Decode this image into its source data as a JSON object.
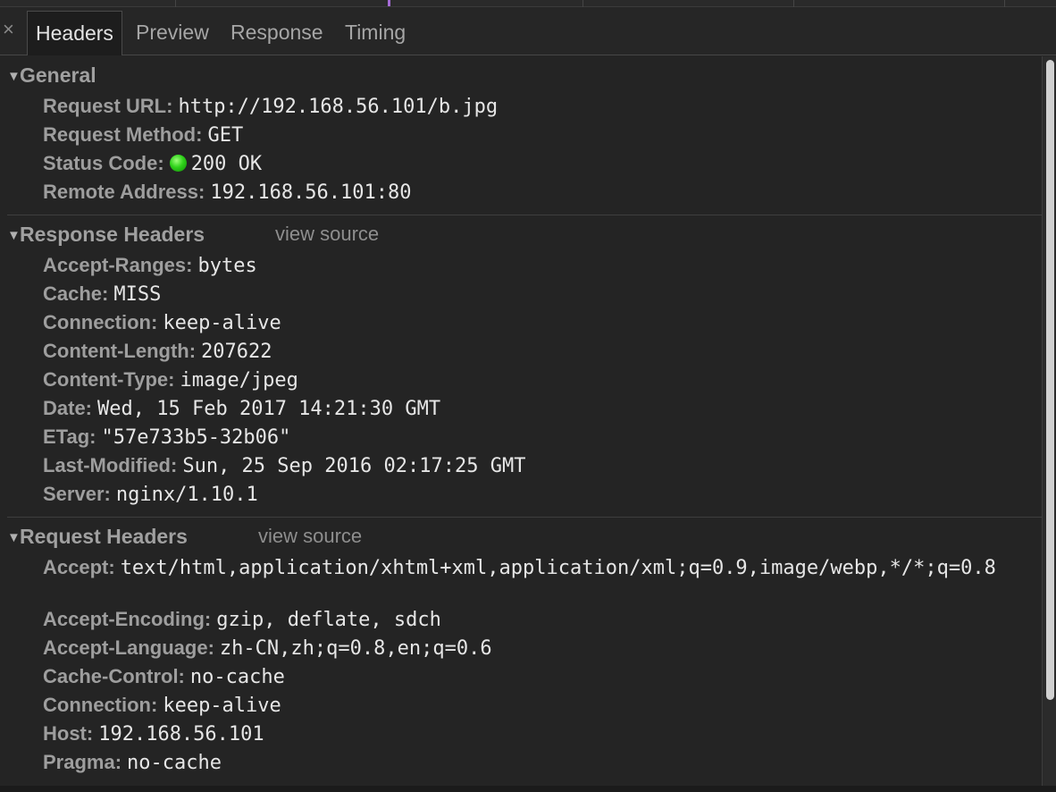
{
  "tabs": [
    {
      "label": "Headers",
      "active": true
    },
    {
      "label": "Preview",
      "active": false
    },
    {
      "label": "Response",
      "active": false
    },
    {
      "label": "Timing",
      "active": false
    }
  ],
  "close_glyph": "×",
  "general": {
    "title": "General",
    "rows": [
      {
        "key": "Request URL:",
        "value": "http://192.168.56.101/b.jpg"
      },
      {
        "key": "Request Method:",
        "value": "GET"
      },
      {
        "key": "Status Code:",
        "value": "200 OK",
        "status_color": "#2fd21a"
      },
      {
        "key": "Remote Address:",
        "value": "192.168.56.101:80"
      }
    ]
  },
  "response_headers": {
    "title": "Response Headers",
    "view_source": "view source",
    "rows": [
      {
        "key": "Accept-Ranges:",
        "value": "bytes"
      },
      {
        "key": "Cache:",
        "value": "MISS"
      },
      {
        "key": "Connection:",
        "value": "keep-alive"
      },
      {
        "key": "Content-Length:",
        "value": "207622"
      },
      {
        "key": "Content-Type:",
        "value": "image/jpeg"
      },
      {
        "key": "Date:",
        "value": "Wed, 15 Feb 2017 14:21:30 GMT"
      },
      {
        "key": "ETag:",
        "value": "\"57e733b5-32b06\""
      },
      {
        "key": "Last-Modified:",
        "value": "Sun, 25 Sep 2016 02:17:25 GMT"
      },
      {
        "key": "Server:",
        "value": "nginx/1.10.1"
      }
    ]
  },
  "request_headers": {
    "title": "Request Headers",
    "view_source": "view source",
    "rows": [
      {
        "key": "Accept:",
        "value": "text/html,application/xhtml+xml,application/xml;q=0.9,image/webp,*/*;q=0.8"
      },
      {
        "key": "Accept-Encoding:",
        "value": "gzip, deflate, sdch"
      },
      {
        "key": "Accept-Language:",
        "value": "zh-CN,zh;q=0.8,en;q=0.6"
      },
      {
        "key": "Cache-Control:",
        "value": "no-cache"
      },
      {
        "key": "Connection:",
        "value": "keep-alive"
      },
      {
        "key": "Host:",
        "value": "192.168.56.101"
      },
      {
        "key": "Pragma:",
        "value": "no-cache"
      }
    ]
  },
  "colors": {
    "background": "#242424",
    "header_key": "#9e9e9e",
    "header_value": "#e6e6e6",
    "status_ok": "#2fd21a"
  }
}
